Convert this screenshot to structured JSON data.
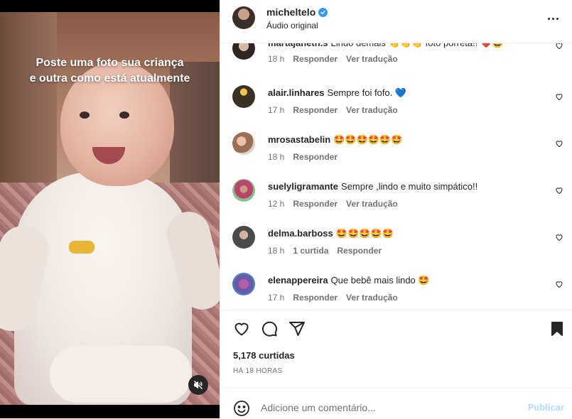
{
  "media": {
    "caption_line1": "Poste uma foto sua criança",
    "caption_line2": "e outra como está atualmente",
    "mute_icon": "speaker-muted-icon"
  },
  "header": {
    "username": "micheltelo",
    "subtitle": "Áudio original",
    "verified_icon": "verified-badge-icon",
    "more_icon": "more-horizontal-icon"
  },
  "comments": [
    {
      "user": "martajaneth.s",
      "text": "Lindo demais 👏👏👏 foto porreta!! ❤️🤩",
      "age": "18 h",
      "reply": "Responder",
      "translate": "Ver tradução"
    },
    {
      "user": "alair.linhares",
      "text": "Sempre foi fofo. 💙",
      "age": "17 h",
      "reply": "Responder",
      "translate": "Ver tradução"
    },
    {
      "user": "mrosastabelin",
      "text": "🤩🤩🤩🤩🤩🤩",
      "age": "18 h",
      "reply": "Responder",
      "translate": ""
    },
    {
      "user": "suelyligramante",
      "text": "Sempre ,lindo e muito simpático!!",
      "age": "12 h",
      "reply": "Responder",
      "translate": "Ver tradução"
    },
    {
      "user": "delma.barboss",
      "text": "🤩🤩🤩🤩🤩",
      "age": "18 h",
      "replies": "1 curtida",
      "reply": "Responder",
      "translate": ""
    },
    {
      "user": "elenappereira",
      "text": "Que bebê mais lindo 🤩",
      "age": "17 h",
      "reply": "Responder",
      "translate": "Ver tradução"
    }
  ],
  "actions": {
    "like_icon": "heart-icon",
    "comment_icon": "comment-bubble-icon",
    "share_icon": "paper-plane-icon",
    "save_icon": "bookmark-icon",
    "likes": "5,178 curtidas",
    "time": "HÁ 18 HORAS"
  },
  "composer": {
    "emoji_icon": "emoji-smile-icon",
    "placeholder": "Adicione um comentário...",
    "publish_label": "Publicar"
  },
  "colors": {
    "link_blue": "#b3dbff",
    "verified_blue": "#3897f0",
    "secondary_text": "#737373"
  }
}
